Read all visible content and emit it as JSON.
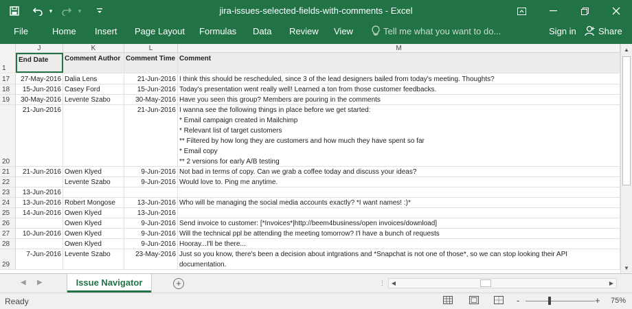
{
  "window": {
    "title": "jira-issues-selected-fields-with-comments - Excel"
  },
  "ribbon": {
    "tabs": [
      "File",
      "Home",
      "Insert",
      "Page Layout",
      "Formulas",
      "Data",
      "Review",
      "View"
    ],
    "tell_me": "Tell me what you want to do...",
    "sign_in": "Sign in",
    "share": "Share"
  },
  "columns": [
    "J",
    "K",
    "L",
    "M"
  ],
  "header_row": {
    "number": "1",
    "end_date": "End Date",
    "comment_author": "Comment Author",
    "comment_time": "Comment Time",
    "comment": "Comment"
  },
  "rows": [
    {
      "num": "17",
      "end_date": "27-May-2016",
      "author": "Dalia Lens",
      "time": "21-Jun-2016",
      "comment": "I think this should be rescheduled, since 3 of the lead designers bailed from today's meeting. Thoughts?"
    },
    {
      "num": "18",
      "end_date": "15-Jun-2016",
      "author": "Casey Ford",
      "time": "15-Jun-2016",
      "comment": "Today's presentation went really well! Learned a ton from those customer feedbacks."
    },
    {
      "num": "19",
      "end_date": "30-May-2016",
      "author": "Levente Szabo",
      "time": "30-May-2016",
      "comment": "Have you seen this group? Members are pouring in the comments"
    },
    {
      "num": "20",
      "end_date": "21-Jun-2016",
      "author": "",
      "time": "21-Jun-2016",
      "comment_lines": [
        "I wanna see the following things in place before we get started:",
        "* Email campaign created in Mailchimp",
        "* Relevant list of target customers",
        "** Filtered by how long they are customers and how much they have spent so far",
        "* Email copy",
        "** 2 versions for early A/B testing"
      ]
    },
    {
      "num": "21",
      "end_date": "21-Jun-2016",
      "author": "Owen Klyed",
      "time": "9-Jun-2016",
      "comment": "Not bad in terms of copy. Can we grab a coffee today and discuss your ideas?"
    },
    {
      "num": "22",
      "end_date": "",
      "author": "Levente Szabo",
      "time": "9-Jun-2016",
      "comment": "Would love to. Ping me anytime."
    },
    {
      "num": "23",
      "end_date": "13-Jun-2016",
      "author": "",
      "time": "",
      "comment": ""
    },
    {
      "num": "24",
      "end_date": "13-Jun-2016",
      "author": "Robert Mongose",
      "time": "13-Jun-2016",
      "comment": "Who will be managing the social media accounts exactly? *I want names! :)*"
    },
    {
      "num": "25",
      "end_date": "14-Jun-2016",
      "author": "Owen Klyed",
      "time": "13-Jun-2016",
      "comment": ""
    },
    {
      "num": "26",
      "end_date": "",
      "author": "Owen Klyed",
      "time": "9-Jun-2016",
      "comment": "Send invoice to customer: [*Invoices*|http://beem4business/open invoices/download]"
    },
    {
      "num": "27",
      "end_date": "10-Jun-2016",
      "author": "Owen Klyed",
      "time": "9-Jun-2016",
      "comment": "Will the technical ppl be attending the meeting tomorrow? I'l have a bunch of requests"
    },
    {
      "num": "28",
      "end_date": "",
      "author": "Owen Klyed",
      "time": "9-Jun-2016",
      "comment": "Hooray...I'll be there..."
    },
    {
      "num": "29",
      "end_date": "7-Jun-2016",
      "author": "Levente Szabo",
      "time": "23-May-2016",
      "comment_lines": [
        "Just so you know, there's been a decision about intgrations and *Snapchat is not one of those*, so we can stop looking their API",
        "documentation."
      ]
    }
  ],
  "sheet": {
    "active_tab": "Issue Navigator"
  },
  "status": {
    "ready": "Ready",
    "zoom": "75%",
    "zoom_minus": "-",
    "zoom_plus": "+"
  },
  "colors": {
    "excel_green": "#217346",
    "sheet_tab_text": "#217346"
  }
}
